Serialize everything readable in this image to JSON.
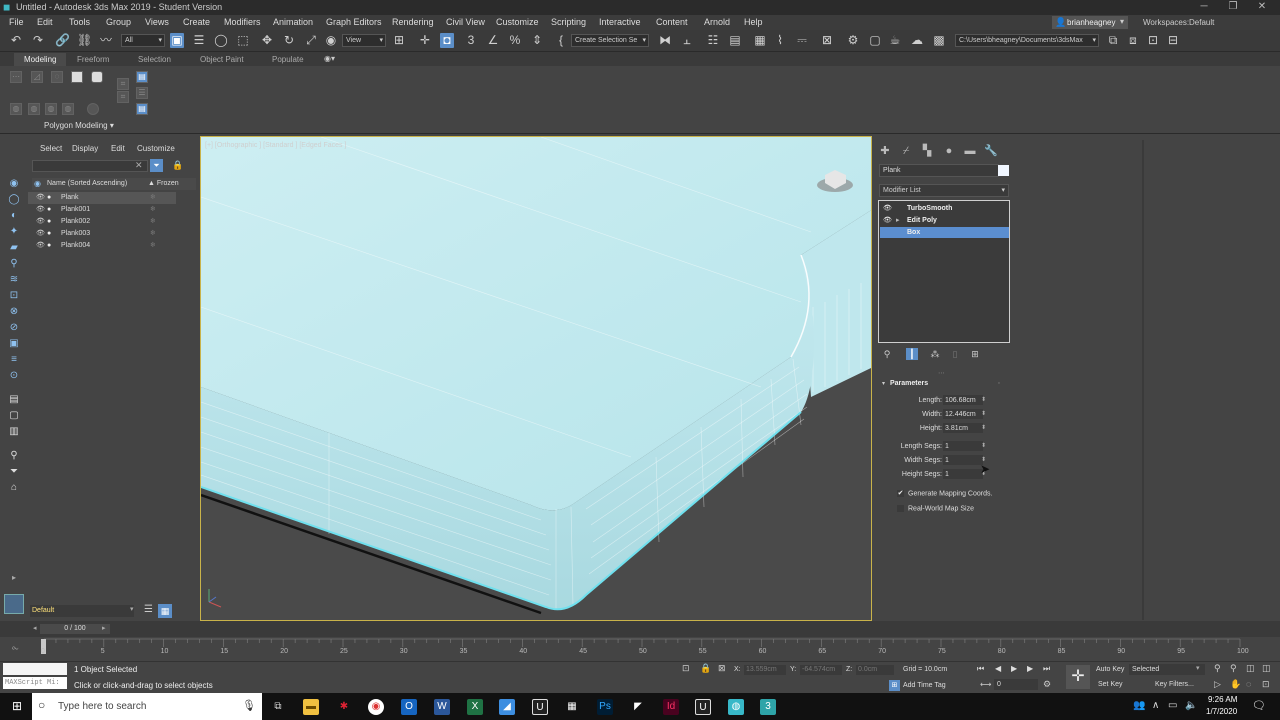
{
  "window": {
    "title": "Untitled - Autodesk 3ds Max 2019 - Student Version",
    "controls": [
      "─",
      "❐",
      "✕"
    ]
  },
  "menus": [
    "File",
    "Edit",
    "Tools",
    "Group",
    "Views",
    "Create",
    "Modifiers",
    "Animation",
    "Graph Editors",
    "Rendering",
    "Civil View",
    "Customize",
    "Scripting",
    "Interactive",
    "Content",
    "Arnold",
    "Help"
  ],
  "user": {
    "name": "brianheagney",
    "workspaces_label": "Workspaces:",
    "workspace": "Default"
  },
  "toolbar": {
    "filter": "All",
    "ref_coord": "View",
    "selection_set": "Create Selection Se",
    "project_path": "C:\\Users\\bheagney\\Documents\\3dsMax"
  },
  "ribbon": {
    "tabs": [
      "Modeling",
      "Freeform",
      "Selection",
      "Object Paint",
      "Populate"
    ],
    "active_tab": "Modeling",
    "panel_label": "Polygon Modeling"
  },
  "scene_explorer": {
    "tabs": [
      "Select",
      "Display",
      "Edit",
      "Customize"
    ],
    "col_name": "Name (Sorted Ascending)",
    "col_frozen": "▲ Frozen",
    "objects": [
      "Plank",
      "Plank001",
      "Plank002",
      "Plank003",
      "Plank004"
    ],
    "selected_index": 0,
    "layer": "Default"
  },
  "viewport": {
    "label": "[+] [Orthographic ] [Standard ] [Edged Faces ]"
  },
  "command_panel": {
    "object_name": "Plank",
    "object_color": "#f0f6ff",
    "modifier_list": "Modifier List",
    "stack": [
      {
        "name": "TurboSmooth",
        "expand": ""
      },
      {
        "name": "Edit Poly",
        "expand": "▸"
      },
      {
        "name": "Box",
        "expand": ""
      }
    ],
    "selected_stack": 2,
    "rollout": "Parameters",
    "params": [
      {
        "label": "Length:",
        "value": "106.68cm"
      },
      {
        "label": "Width:",
        "value": "12.446cm"
      },
      {
        "label": "Height:",
        "value": "3.81cm"
      },
      {
        "label": "Length Segs:",
        "value": "1"
      },
      {
        "label": "Width Segs:",
        "value": "1"
      },
      {
        "label": "Height Segs:",
        "value": "1"
      }
    ],
    "gen_mapping": "Generate Mapping Coords.",
    "gen_mapping_checked": "✔",
    "real_world": "Real-World Map Size"
  },
  "timeline": {
    "frame_label": "0 / 100",
    "ticks": [
      "0",
      "5",
      "10",
      "15",
      "20",
      "25",
      "30",
      "35",
      "40",
      "45",
      "50",
      "55",
      "60",
      "65",
      "70",
      "75",
      "80",
      "85",
      "90",
      "95",
      "100"
    ]
  },
  "status": {
    "maxscript": "MAXScript Mi:",
    "selected": "1 Object Selected",
    "prompt": "Click or click-and-drag to select objects",
    "x_label": "X:",
    "x_value": "13.559cm",
    "y_label": "Y:",
    "y_value": "-64.574cm",
    "z_label": "Z:",
    "z_value": "0.0cm",
    "grid": "Grid = 10.0cm",
    "add_time_tag": "Add Time Tag",
    "frame": "0",
    "auto_key": "Auto Key",
    "set_key": "Set Key",
    "key_mode": "Selected",
    "key_filters": "Key Filters..."
  },
  "taskbar": {
    "search_placeholder": "Type here to search",
    "time": "9:26 AM",
    "date": "1/7/2020"
  }
}
